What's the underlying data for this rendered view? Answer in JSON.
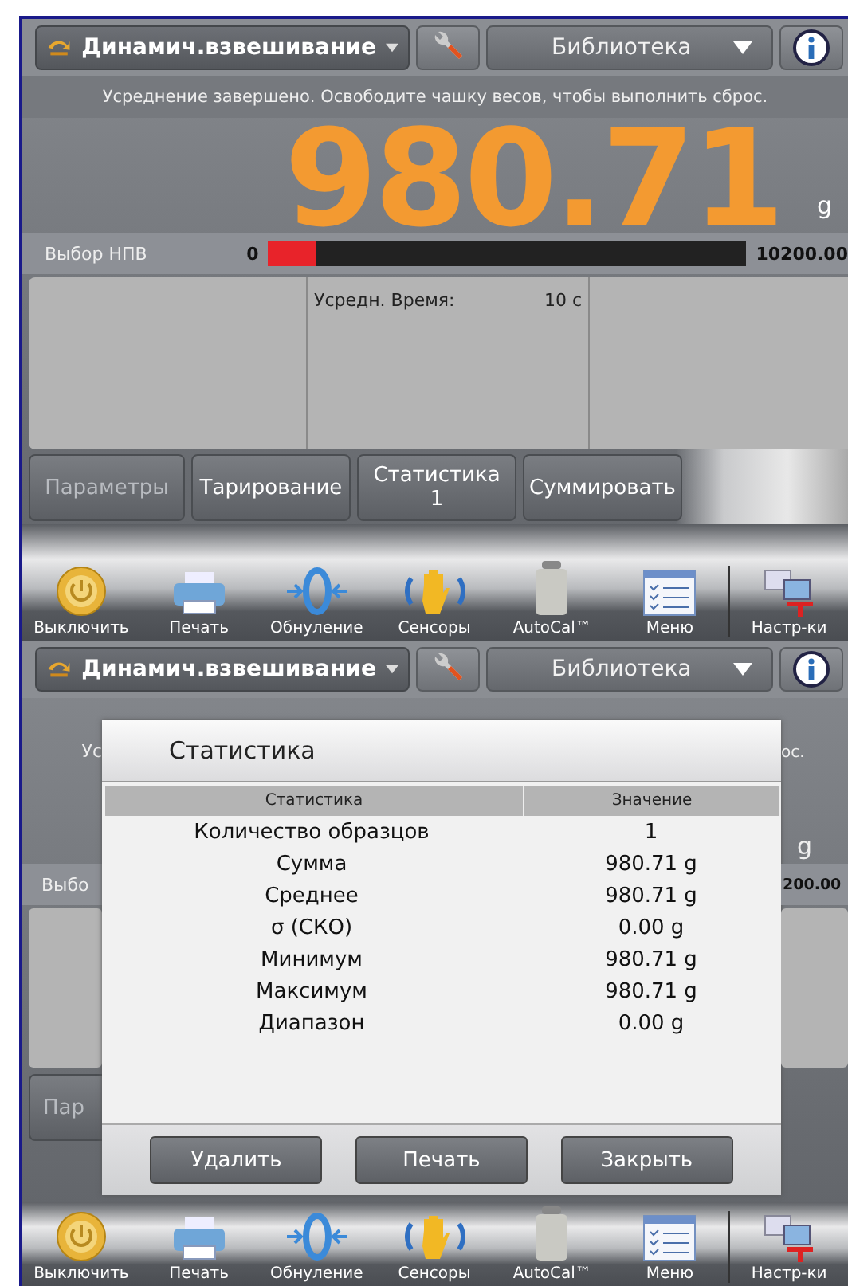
{
  "screen_1": {
    "header": {
      "mode": "Динамич.взвешивание",
      "library": "Библиотека"
    },
    "message": "Усреднение завершено.  Освободите чашку весов, чтобы выполнить сброс.",
    "readout": {
      "value": "980.71",
      "unit": "g"
    },
    "capacity": {
      "label": "Выбор НПВ",
      "min": "0",
      "max": "10200.00",
      "level": 0.1
    },
    "info": {
      "label": "Усредн. Время:",
      "value": "10 с"
    },
    "buttons": [
      {
        "label": "Параметры",
        "disabled": true
      },
      {
        "label": "Тарирование",
        "disabled": false
      },
      {
        "label": "Статистика",
        "count": "1",
        "disabled": false
      },
      {
        "label": "Суммировать",
        "disabled": false
      }
    ],
    "toolbar": [
      {
        "kind": "power",
        "label": "Выключить"
      },
      {
        "kind": "printer",
        "label": "Печать"
      },
      {
        "kind": "zero",
        "label": "Обнуление"
      },
      {
        "kind": "sensor",
        "label": "Сенсоры"
      },
      {
        "kind": "weight",
        "label": "AutoCal™"
      },
      {
        "kind": "menu",
        "label": "Меню"
      },
      {
        "kind": "setup",
        "label": "Настр-ки"
      }
    ]
  },
  "screen_2": {
    "header": {
      "mode": "Динамич.взвешивание",
      "library": "Библиотека"
    },
    "background_left": {
      "message": "Ус",
      "capacity_label": "Выбо",
      "button": "Пар"
    },
    "background_right": {
      "message": "ос.",
      "unit": "g",
      "capacity_max": "200.00"
    },
    "dialog": {
      "title": "Статистика",
      "columns": [
        "Статистика",
        "Значение"
      ],
      "rows": [
        {
          "statistic": "Количество образцов",
          "value": "1"
        },
        {
          "statistic": "Сумма",
          "value": "980.71 g"
        },
        {
          "statistic": "Среднее",
          "value": "980.71 g"
        },
        {
          "statistic": "σ (СКО)",
          "value": "0.00 g"
        },
        {
          "statistic": "Минимум",
          "value": "980.71 g"
        },
        {
          "statistic": "Максимум",
          "value": "980.71 g"
        },
        {
          "statistic": "Диапазон",
          "value": "0.00 g"
        }
      ],
      "buttons": [
        "Удалить",
        "Печать",
        "Закрыть"
      ]
    },
    "toolbar": [
      {
        "kind": "power",
        "label": "Выключить"
      },
      {
        "kind": "printer",
        "label": "Печать"
      },
      {
        "kind": "zero",
        "label": "Обнуление"
      },
      {
        "kind": "sensor",
        "label": "Сенсоры"
      },
      {
        "kind": "weight",
        "label": "AutoCal™"
      },
      {
        "kind": "menu",
        "label": "Меню"
      },
      {
        "kind": "setup",
        "label": "Настр-ки"
      }
    ]
  }
}
